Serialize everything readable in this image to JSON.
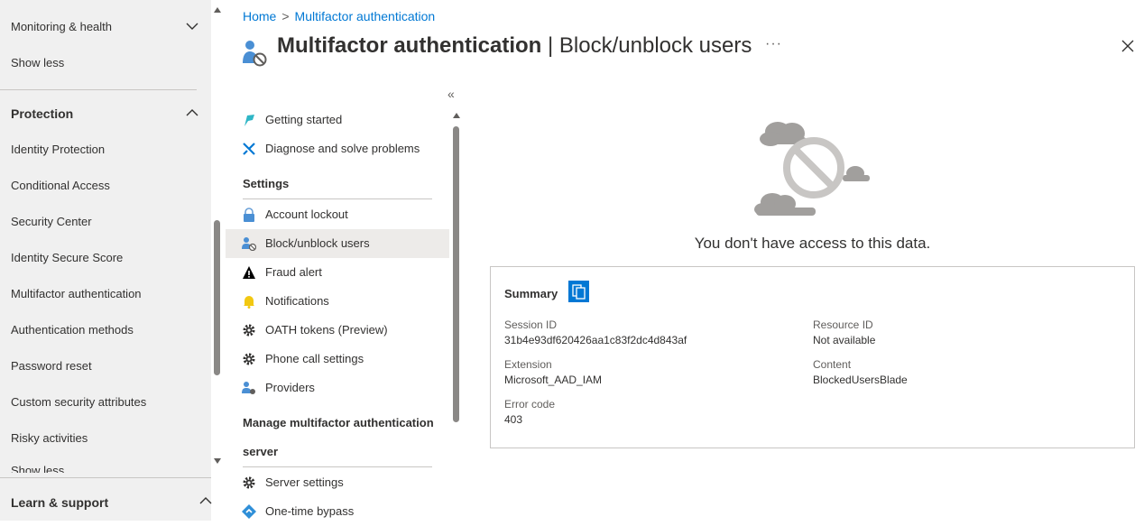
{
  "left_nav": {
    "items": [
      {
        "label": "Monitoring & health"
      },
      {
        "label": "Show less"
      },
      {
        "label": "Protection"
      },
      {
        "label": "Identity Protection"
      },
      {
        "label": "Conditional Access"
      },
      {
        "label": "Security Center"
      },
      {
        "label": "Identity Secure Score"
      },
      {
        "label": "Multifactor authentication"
      },
      {
        "label": "Authentication methods"
      },
      {
        "label": "Password reset"
      },
      {
        "label": "Custom security attributes"
      },
      {
        "label": "Risky activities"
      },
      {
        "label": "Show less"
      }
    ],
    "bottom_section": "Learn & support"
  },
  "breadcrumb": {
    "home": "Home",
    "current": "Multifactor authentication"
  },
  "header": {
    "title_bold": "Multifactor authentication",
    "separator": " | ",
    "title_light": "Block/unblock users",
    "more": "···"
  },
  "menu": {
    "collapse_glyph": "«",
    "items_top": [
      {
        "label": "Getting started",
        "icon": "getting-started-icon"
      },
      {
        "label": "Diagnose and solve problems",
        "icon": "wrench-icon"
      }
    ],
    "settings_header": "Settings",
    "settings_items": [
      {
        "label": "Account lockout",
        "icon": "lock-icon"
      },
      {
        "label": "Block/unblock users",
        "icon": "blocked-user-icon",
        "selected": true
      },
      {
        "label": "Fraud alert",
        "icon": "warning-icon"
      },
      {
        "label": "Notifications",
        "icon": "bell-icon"
      },
      {
        "label": "OATH tokens (Preview)",
        "icon": "gear-icon"
      },
      {
        "label": "Phone call settings",
        "icon": "gear-icon"
      },
      {
        "label": "Providers",
        "icon": "provider-icon"
      }
    ],
    "server_header_line1": "Manage multifactor authentication",
    "server_header_line2": "server",
    "server_items": [
      {
        "label": "Server settings",
        "icon": "gear-icon"
      },
      {
        "label": "One-time bypass",
        "icon": "bypass-icon"
      }
    ]
  },
  "content": {
    "message": "You don't have access to this data.",
    "summary": {
      "title": "Summary",
      "session_id_label": "Session ID",
      "session_id": "31b4e93df620426aa1c83f2dc4d843af",
      "resource_id_label": "Resource ID",
      "resource_id": "Not available",
      "extension_label": "Extension",
      "extension": "Microsoft_AAD_IAM",
      "content_label": "Content",
      "content": "BlockedUsersBlade",
      "error_code_label": "Error code",
      "error_code": "403"
    }
  },
  "colors": {
    "accent": "#0078d4",
    "nav_bg": "#f0f0f0",
    "selected_bg": "#edebe9"
  }
}
